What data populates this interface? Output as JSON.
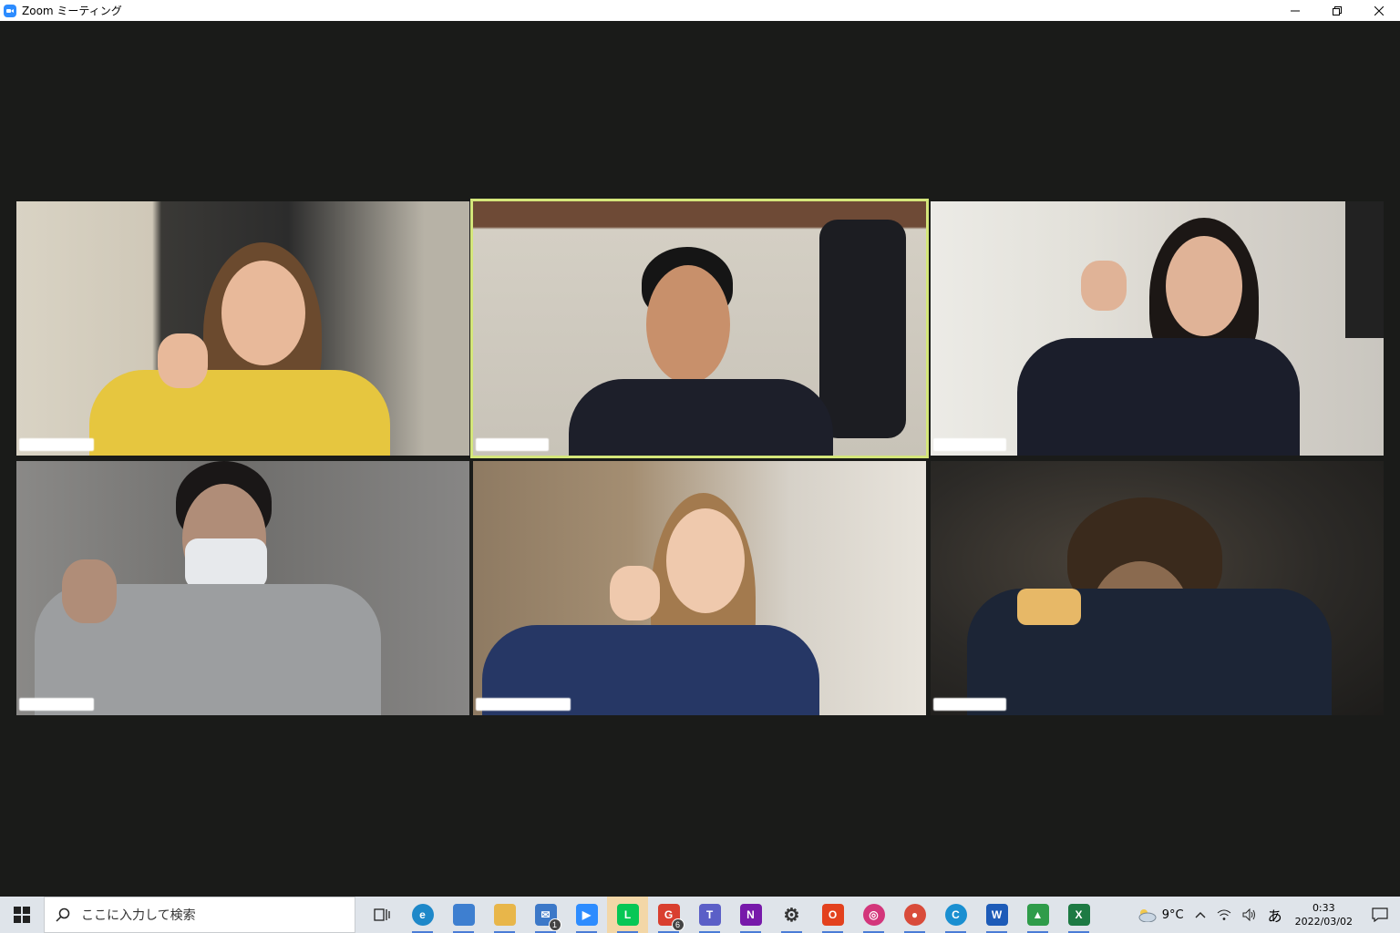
{
  "window": {
    "title": "Zoom ミーティング",
    "controls": {
      "minimize": "—",
      "restore": "❐",
      "close": "✕"
    }
  },
  "meeting": {
    "active_speaker_color": "#d4e67a",
    "participants": [
      {
        "id": "p1",
        "shirt": "#e6c63f",
        "hair": "#6b4a2e",
        "skin": "#e8b99a",
        "bg": "#b8b2a6",
        "speaking": false
      },
      {
        "id": "p2",
        "shirt": "#1d1f2a",
        "hair": "#151515",
        "skin": "#c8906b",
        "bg": "#c9c4b7",
        "speaking": true
      },
      {
        "id": "p3",
        "shirt": "#1b1e2b",
        "hair": "#1c1715",
        "skin": "#e0b397",
        "bg": "#d7d3cc",
        "speaking": false
      },
      {
        "id": "p4",
        "shirt": "#9c9ea0",
        "hair": "#1a1717",
        "skin": "#b08d78",
        "bg": "#7b7a79",
        "speaking": false
      },
      {
        "id": "p5",
        "shirt": "#263765",
        "hair": "#a37a4e",
        "skin": "#efc9ad",
        "bg": "#b7a48d",
        "speaking": false
      },
      {
        "id": "p6",
        "shirt": "#1c2536",
        "hair": "#3a2a1c",
        "skin": "#8a6a4f",
        "bg": "#2c2a27",
        "speaking": false
      }
    ]
  },
  "taskbar": {
    "search_placeholder": "ここに入力して検索",
    "apps": [
      {
        "name": "task-view",
        "label": "",
        "color": "#333333",
        "badge": ""
      },
      {
        "name": "edge",
        "label": "e",
        "color": "#1e88c9",
        "badge": ""
      },
      {
        "name": "store",
        "label": "",
        "color": "#3e7fd0",
        "badge": ""
      },
      {
        "name": "file-explorer",
        "label": "",
        "color": "#e8b64a",
        "badge": ""
      },
      {
        "name": "mail",
        "label": "✉",
        "color": "#3c78c8",
        "badge": "1"
      },
      {
        "name": "zoom",
        "label": "▶",
        "color": "#2d8cff",
        "badge": ""
      },
      {
        "name": "line",
        "label": "L",
        "color": "#06c755",
        "badge": ""
      },
      {
        "name": "gmail",
        "label": "G",
        "color": "#d93f2f",
        "badge": "6"
      },
      {
        "name": "teams",
        "label": "T",
        "color": "#5b5fc7",
        "badge": ""
      },
      {
        "name": "onenote",
        "label": "N",
        "color": "#7719aa",
        "badge": ""
      },
      {
        "name": "settings",
        "label": "⚙",
        "color": "#333333",
        "badge": ""
      },
      {
        "name": "office",
        "label": "O",
        "color": "#e3411e",
        "badge": ""
      },
      {
        "name": "instagram",
        "label": "◎",
        "color": "#d3367b",
        "badge": ""
      },
      {
        "name": "chrome-app",
        "label": "●",
        "color": "#d94b3a",
        "badge": ""
      },
      {
        "name": "cortana",
        "label": "C",
        "color": "#1a8fd1",
        "badge": ""
      },
      {
        "name": "word",
        "label": "W",
        "color": "#1d5bb8",
        "badge": ""
      },
      {
        "name": "green-app",
        "label": "▲",
        "color": "#2f9c4a",
        "badge": ""
      },
      {
        "name": "excel",
        "label": "X",
        "color": "#1d7a43",
        "badge": ""
      }
    ],
    "tray": {
      "weather": "9°C",
      "ime": "あ",
      "time": "0:33",
      "date": "2022/03/02"
    }
  }
}
